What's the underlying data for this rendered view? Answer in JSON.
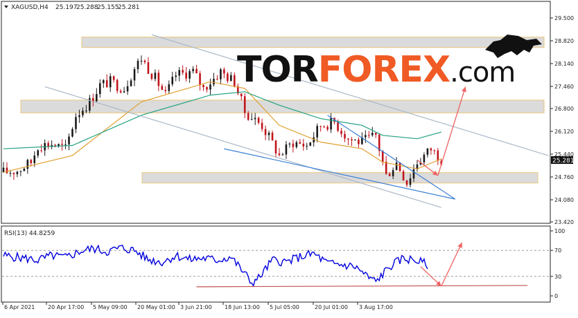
{
  "header": {
    "symbol": "XAGUSD,H4",
    "open": "25.197",
    "high": "25.288",
    "low": "25.155",
    "close": "25.281"
  },
  "logo": {
    "part1": "TOR",
    "part2": "FOREX",
    "part3": ".com",
    "color_dark": "#111111",
    "color_accent": "#f05a24"
  },
  "colors": {
    "bull": "#1a1a1a",
    "bear": "#c0141c",
    "ma_fast": "#e0a030",
    "ma_slow": "#20a080",
    "channel": "#a8b8c8",
    "wedge": "#3a7fd5",
    "arrow": "#f06060",
    "zone_fill": "#d8d8d8",
    "zone_border": "#e8c070",
    "rsi_line": "#0000dd",
    "rsi_support": "#c05050"
  },
  "chart_data": [
    {
      "type": "candlestick",
      "symbol": "XAGUSD",
      "timeframe": "H4",
      "current_price": "25.281",
      "price_axis": {
        "ticks": [
          "29.500",
          "28.820",
          "28.140",
          "27.460",
          "26.800",
          "26.120",
          "25.440",
          "24.760",
          "24.080",
          "23.420"
        ],
        "range": [
          23.42,
          29.5
        ]
      },
      "time_axis": {
        "ticks": [
          "6 Apr 2021",
          "20 Apr 17:00",
          "5 May 09:00",
          "20 May 01:00",
          "3 Jun 21:00",
          "18 Jun 13:00",
          "5 Jul 05:00",
          "20 Jul 01:00",
          "3 Aug 17:00"
        ]
      },
      "price_path": [
        [
          0,
          24.9
        ],
        [
          4,
          24.95
        ],
        [
          8,
          25.2
        ],
        [
          10,
          25.7
        ],
        [
          14,
          25.75
        ],
        [
          18,
          25.6
        ],
        [
          21,
          26.6
        ],
        [
          25,
          27.0
        ],
        [
          28,
          27.5
        ],
        [
          31,
          27.6
        ],
        [
          35,
          27.4
        ],
        [
          38,
          28.0
        ],
        [
          40,
          28.3
        ],
        [
          44,
          27.7
        ],
        [
          47,
          27.2
        ],
        [
          50,
          27.8
        ],
        [
          55,
          27.9
        ],
        [
          58,
          27.4
        ],
        [
          63,
          27.9
        ],
        [
          67,
          27.6
        ],
        [
          70,
          26.7
        ],
        [
          75,
          26.3
        ],
        [
          80,
          25.4
        ],
        [
          84,
          25.8
        ],
        [
          88,
          25.7
        ],
        [
          92,
          26.3
        ],
        [
          96,
          26.4
        ],
        [
          100,
          25.9
        ],
        [
          104,
          25.8
        ],
        [
          108,
          26.0
        ],
        [
          111,
          24.8
        ],
        [
          114,
          25.2
        ],
        [
          117,
          24.6
        ],
        [
          120,
          25.2
        ],
        [
          124,
          25.6
        ],
        [
          127,
          25.3
        ]
      ],
      "moving_averages": [
        {
          "color": "#e0a030",
          "path": [
            [
              0,
              24.9
            ],
            [
              20,
              25.4
            ],
            [
              40,
              27.0
            ],
            [
              60,
              27.6
            ],
            [
              70,
              27.4
            ],
            [
              80,
              26.3
            ],
            [
              92,
              25.8
            ],
            [
              104,
              25.6
            ],
            [
              110,
              25.2
            ],
            [
              120,
              25.0
            ],
            [
              127,
              25.3
            ]
          ]
        },
        {
          "color": "#20a080",
          "path": [
            [
              0,
              25.6
            ],
            [
              20,
              25.7
            ],
            [
              40,
              26.6
            ],
            [
              60,
              27.2
            ],
            [
              70,
              27.3
            ],
            [
              80,
              26.9
            ],
            [
              92,
              26.5
            ],
            [
              104,
              26.3
            ],
            [
              110,
              26.0
            ],
            [
              120,
              25.9
            ],
            [
              127,
              26.1
            ]
          ]
        }
      ],
      "support_zones": [
        {
          "top": 28.93,
          "bottom": 28.62
        },
        {
          "top": 27.05,
          "bottom": 26.67
        },
        {
          "top": 24.89,
          "bottom": 24.58
        }
      ],
      "trend_lines": [
        {
          "color": "#a8b8c8",
          "from": [
            43,
            29.0
          ],
          "to": [
            158,
            25.4
          ]
        },
        {
          "color": "#a8b8c8",
          "from": [
            12,
            27.45
          ],
          "to": [
            127,
            23.85
          ]
        },
        {
          "color": "#3a7fd5",
          "from": [
            64,
            25.6
          ],
          "to": [
            131,
            24.1
          ]
        },
        {
          "color": "#3a7fd5",
          "from": [
            94,
            26.6
          ],
          "to": [
            131,
            24.1
          ]
        }
      ],
      "forecast_arrows": [
        {
          "from": [
            120,
            25.27
          ],
          "to": [
            126,
            24.8
          ]
        },
        {
          "from": [
            126,
            24.8
          ],
          "to": [
            134,
            27.45
          ]
        }
      ]
    },
    {
      "type": "line",
      "title": "RSI(13) 44.8259",
      "indicator": "RSI(13)",
      "value": "44.8259",
      "y_ticks": [
        "100",
        "70",
        "30",
        "0"
      ],
      "levels": [
        70,
        30
      ],
      "ylim": [
        0,
        100
      ],
      "values": [
        [
          0,
          62
        ],
        [
          6,
          58
        ],
        [
          10,
          55
        ],
        [
          14,
          62
        ],
        [
          18,
          59
        ],
        [
          22,
          68
        ],
        [
          26,
          73
        ],
        [
          30,
          68
        ],
        [
          34,
          74
        ],
        [
          38,
          70
        ],
        [
          42,
          56
        ],
        [
          46,
          52
        ],
        [
          50,
          62
        ],
        [
          54,
          56
        ],
        [
          58,
          58
        ],
        [
          62,
          55
        ],
        [
          66,
          60
        ],
        [
          70,
          34
        ],
        [
          72,
          20
        ],
        [
          74,
          27
        ],
        [
          78,
          55
        ],
        [
          82,
          52
        ],
        [
          86,
          60
        ],
        [
          90,
          65
        ],
        [
          94,
          50
        ],
        [
          98,
          48
        ],
        [
          102,
          45
        ],
        [
          106,
          28
        ],
        [
          108,
          22
        ],
        [
          112,
          45
        ],
        [
          116,
          58
        ],
        [
          120,
          54
        ],
        [
          123,
          48
        ]
      ],
      "support_line": {
        "from": [
          56,
          14
        ],
        "to": [
          152,
          16
        ]
      },
      "forecast_arrows": [
        {
          "from": [
            121,
            45
          ],
          "to": [
            127,
            15
          ]
        },
        {
          "from": [
            127,
            15
          ],
          "to": [
            133,
            82
          ]
        }
      ]
    }
  ]
}
